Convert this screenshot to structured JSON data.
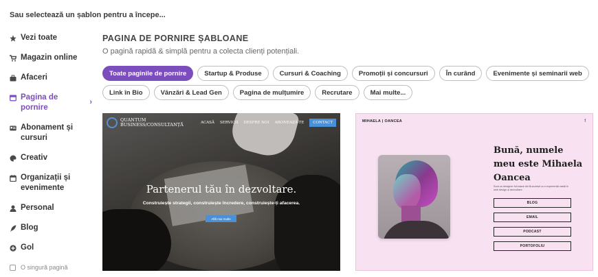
{
  "top_heading": "Sau selectează un șablon pentru a începe...",
  "sidebar": {
    "items": [
      {
        "label": "Vezi toate",
        "icon": "star-icon"
      },
      {
        "label": "Magazin online",
        "icon": "cart-icon"
      },
      {
        "label": "Afaceri",
        "icon": "briefcase-icon"
      },
      {
        "label": "Pagina de pornire",
        "icon": "browser-window-icon",
        "active": true
      },
      {
        "label": "Abonament și cursuri",
        "icon": "id-card-icon"
      },
      {
        "label": "Creativ",
        "icon": "palette-icon"
      },
      {
        "label": "Organizații și evenimente",
        "icon": "calendar-icon"
      },
      {
        "label": "Personal",
        "icon": "person-icon"
      },
      {
        "label": "Blog",
        "icon": "quill-icon"
      },
      {
        "label": "Gol",
        "icon": "plus-circle-icon"
      }
    ],
    "footer_checkbox_label": "O singură pagină"
  },
  "section": {
    "title": "PAGINA DE PORNIRE ȘABLOANE",
    "subtitle": "O pagină rapidă & simplă pentru a colecta clienți potențiali."
  },
  "chips": [
    {
      "label": "Toate paginile de pornire",
      "active": true
    },
    {
      "label": "Startup & Produse"
    },
    {
      "label": "Cursuri & Coaching"
    },
    {
      "label": "Promoții și concursuri"
    },
    {
      "label": "În curând"
    },
    {
      "label": "Evenimente și seminarii web"
    },
    {
      "label": "Link în Bio"
    },
    {
      "label": "Vânzări & Lead Gen"
    },
    {
      "label": "Pagina de mulțumire"
    },
    {
      "label": "Recrutare"
    },
    {
      "label": "Mai multe..."
    }
  ],
  "template1": {
    "logo_line1": "QUANTUM",
    "logo_line2": "BUSINESS/CONSULTANȚĂ",
    "nav": [
      "ACASĂ",
      "SERVICII",
      "DESPRE NOI",
      "ABONEAZĂ-TE"
    ],
    "nav_cta": "CONTACT",
    "headline": "Partenerul tău în dezvoltare.",
    "subheadline": "Construiește strategii, construiește încredere, construiește-ți afacerea.",
    "button": "Află mai multe"
  },
  "template2": {
    "brand": "MIHAELA | OANCEA",
    "social": "f",
    "headline": "Bună, numele meu este Mihaela Oancea",
    "description": "Sunt un designer full-stack din București cu o experiență vastă în web design și dezvoltare.",
    "buttons": [
      "BLOG",
      "EMAIL",
      "PODCAST",
      "PORTOFOLIU"
    ],
    "background": "#f8e1f1"
  },
  "colors": {
    "accent": "#7c4dbd",
    "template1_button": "#4a90d9"
  }
}
